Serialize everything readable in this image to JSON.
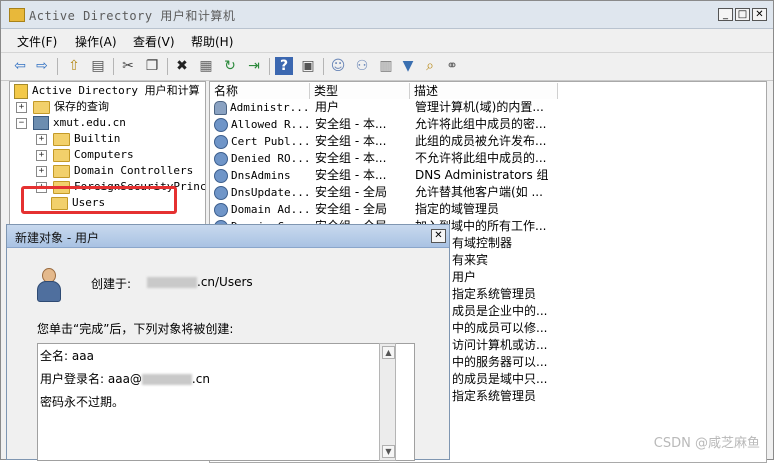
{
  "window": {
    "title": "Active Directory 用户和计算机",
    "minimize_glyph": "_",
    "maximize_glyph": "□",
    "close_glyph": "✕"
  },
  "menu": [
    "文件(F)",
    "操作(A)",
    "查看(V)",
    "帮助(H)"
  ],
  "toolbar": {
    "icons": [
      "back-arrow-icon",
      "forward-arrow-icon",
      "up-folder-icon",
      "show-tree-icon",
      "cut-icon",
      "copy-icon",
      "delete-icon",
      "properties-icon",
      "refresh-icon",
      "export-icon",
      "help-icon",
      "details-icon",
      "new-user-icon",
      "new-group-icon",
      "new-ou-icon",
      "filter-icon",
      "find-icon",
      "add-to-group-icon"
    ],
    "glyphs": [
      "⇦",
      "⇨",
      "⇧",
      "▤",
      "✂",
      "❐",
      "✖",
      "▦",
      "↻",
      "⇥",
      "?",
      "▣",
      "☺",
      "⚇",
      "▥",
      "▼",
      "⌕",
      "⚭"
    ]
  },
  "tree": {
    "root": "Active Directory 用户和计算",
    "saved_queries": "保存的查询",
    "domain": "xmut.edu.cn",
    "children": [
      "Builtin",
      "Computers",
      "Domain Controllers",
      "ForeignSecurityPrincip",
      "Users"
    ],
    "expanders": {
      "saved_queries": "+",
      "domain": "−",
      "builtin": "+",
      "computers": "+",
      "dc": "+",
      "fsp": "+"
    }
  },
  "list": {
    "headers": {
      "name": "名称",
      "type": "类型",
      "description": "描述"
    },
    "rows": [
      {
        "name": "Administr...",
        "type": "用户",
        "desc": "管理计算机(域)的内置...",
        "icon": "user"
      },
      {
        "name": "Allowed R...",
        "type": "安全组 - 本...",
        "desc": "允许将此组中成员的密...",
        "icon": "group"
      },
      {
        "name": "Cert Publ...",
        "type": "安全组 - 本...",
        "desc": "此组的成员被允许发布...",
        "icon": "group"
      },
      {
        "name": "Denied RO...",
        "type": "安全组 - 本...",
        "desc": "不允许将此组中成员的...",
        "icon": "group"
      },
      {
        "name": "DnsAdmins",
        "type": "安全组 - 本...",
        "desc": "DNS Administrators 组",
        "icon": "group"
      },
      {
        "name": "DnsUpdate...",
        "type": "安全组 - 全局",
        "desc": "允许替其他客户端(如 ...",
        "icon": "group"
      },
      {
        "name": "Domain Ad...",
        "type": "安全组 - 全局",
        "desc": "指定的域管理员",
        "icon": "group"
      },
      {
        "name": "Domain C...",
        "type": "安全组 - 全局",
        "desc": "加入到域中的所有工作...",
        "icon": "group"
      }
    ],
    "partial_desc": [
      "有域控制器",
      "有来宾",
      "用户",
      "指定系统管理员",
      "成员是企业中的...",
      "中的成员可以修...",
      "访问计算机或访...",
      "中的服务器可以...",
      "的成员是域中只...",
      "指定系统管理员"
    ]
  },
  "dialog": {
    "title": "新建对象 - 用户",
    "close_glyph": "✕",
    "created_in_label": "创建于:",
    "created_in_value": ".cn/Users",
    "finish_text": "您单击“完成”后，下列对象将被创建:",
    "summary": {
      "fullname": "全名: aaa",
      "logon_prefix": "用户登录名: aaa@",
      "logon_suffix": ".cn",
      "password_note": "密码永不过期。"
    },
    "scroll_up": "▲",
    "scroll_down": "▼"
  },
  "watermark": "CSDN @咸芝麻鱼"
}
